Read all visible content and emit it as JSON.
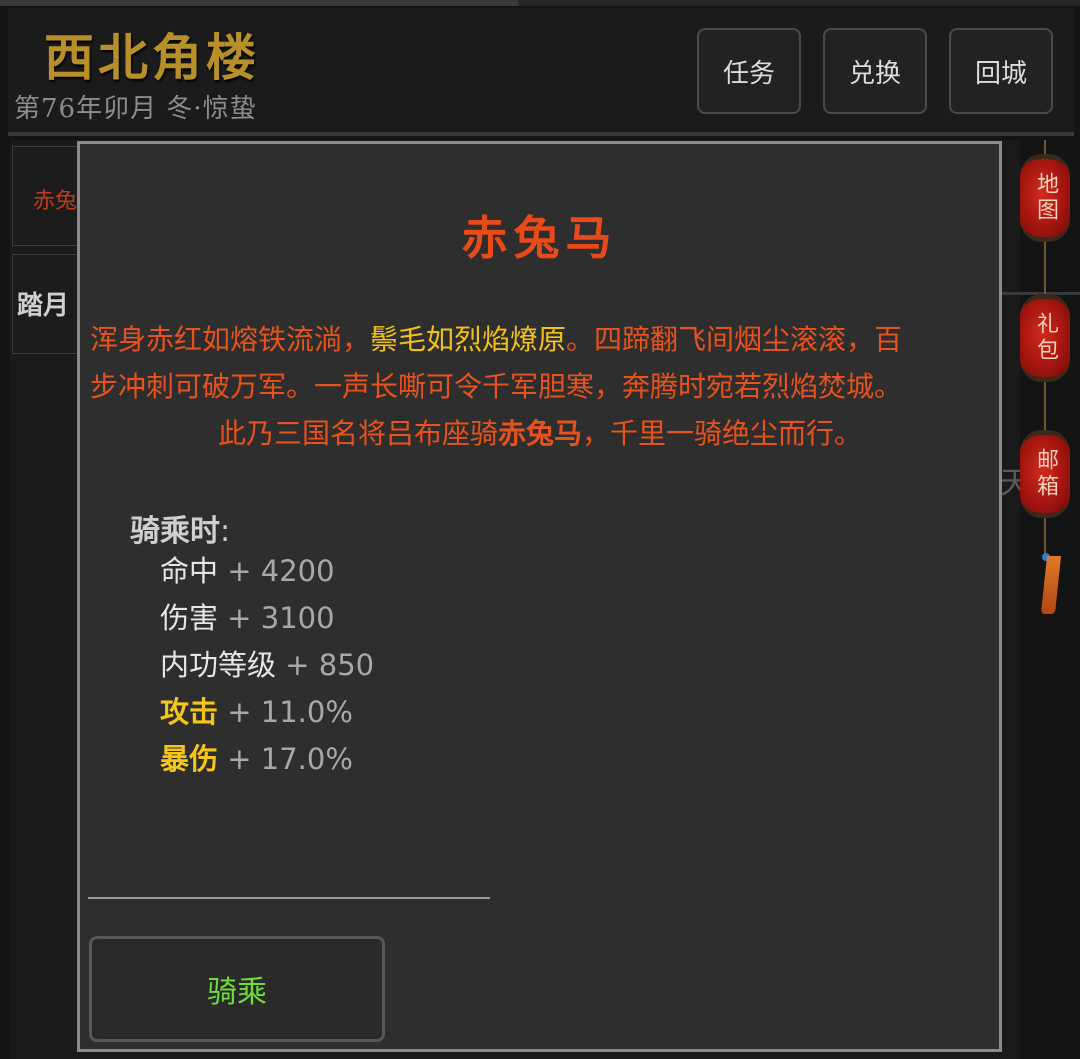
{
  "header": {
    "title": "西北角楼",
    "date": "第76年卯月 冬·惊蛰",
    "buttons": [
      "任务",
      "兑换",
      "回城"
    ]
  },
  "background": {
    "list_items": [
      "赤兔",
      "踏月"
    ],
    "right_text": "天"
  },
  "side_menu": [
    "地图",
    "礼包",
    "邮箱"
  ],
  "modal": {
    "title": "赤兔马",
    "desc_line1_a": "浑身赤红如熔铁流淌，",
    "desc_line1_b": "鬃毛如烈焰燎原",
    "desc_line1_c": "。四蹄翻飞间烟尘滚滚，百",
    "desc_line2": "步冲刺可破万军。一声长嘶可令千军胆寒，奔腾时宛若烈焰焚城。",
    "desc_line3_a": "此乃三国名将吕布座骑",
    "desc_line3_b": "赤兔马",
    "desc_line3_c": "，千里一骑绝尘而行。",
    "stats_label": "骑乘时",
    "stats_colon": ":",
    "stats": [
      {
        "name": "命中",
        "value": "+ 4200",
        "highlight": false
      },
      {
        "name": "伤害",
        "value": "+ 3100",
        "highlight": false
      },
      {
        "name": "内功等级",
        "value": "+ 850",
        "highlight": false
      },
      {
        "name": "攻击",
        "value": "+ 11.0%",
        "highlight": true
      },
      {
        "name": "暴伤",
        "value": "+ 17.0%",
        "highlight": true
      }
    ],
    "action_button": "骑乘"
  },
  "colors": {
    "title_gold": "#b8902a",
    "accent_red": "#e84a1a",
    "stat_gold": "#f5c518",
    "action_green": "#6fdc3a"
  }
}
